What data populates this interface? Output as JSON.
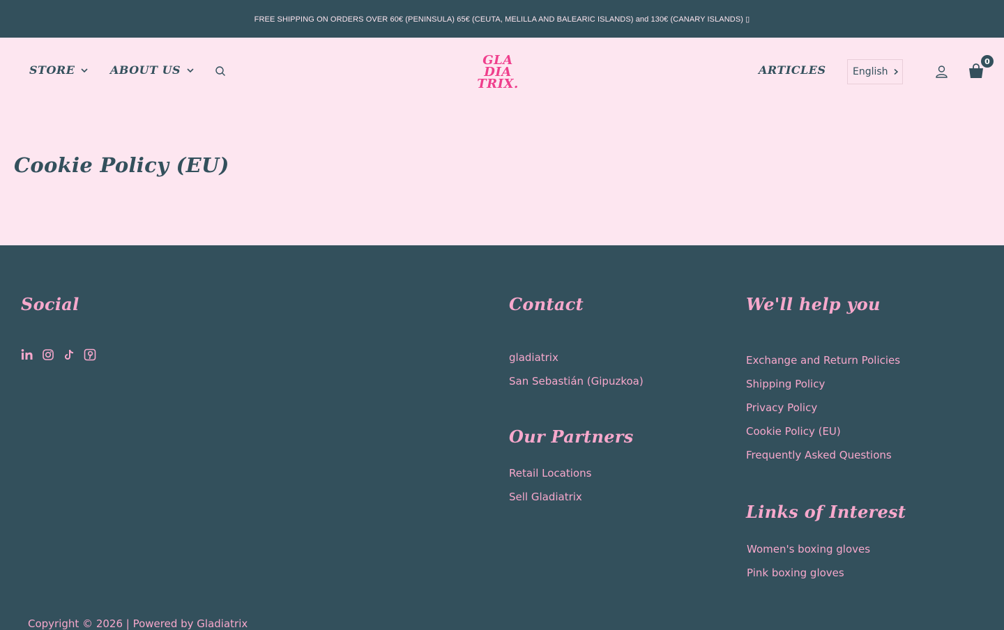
{
  "announcement": "FREE SHIPPING ON ORDERS OVER 60€ (PENINSULA) 65€ (CEUTA, MELILLA AND BALEARIC ISLANDS) and 130€ (CANARY ISLANDS) ▯",
  "nav": {
    "store": "STORE",
    "about": "ABOUT US",
    "articles": "ARTICLES",
    "language": "English",
    "cart_count": "0"
  },
  "logo": [
    "GLA",
    "DIA",
    "TRIX."
  ],
  "page": {
    "title": "Cookie Policy (EU)"
  },
  "footer": {
    "social": {
      "heading": "Social",
      "icons": [
        "linkedin-icon",
        "instagram-icon",
        "tiktok-icon",
        "pinterest-icon"
      ]
    },
    "contact": {
      "heading": "Contact",
      "items": [
        "gladiatrix",
        "San Sebastián (Gipuzkoa)"
      ]
    },
    "partners": {
      "heading": "Our Partners",
      "items": [
        "Retail Locations",
        "Sell Gladiatrix"
      ]
    },
    "help": {
      "heading": "We'll help you",
      "items": [
        "Exchange and Return Policies",
        "Shipping Policy",
        "Privacy Policy",
        "Cookie Policy (EU)",
        "Frequently Asked Questions"
      ]
    },
    "interest": {
      "heading": "Links of Interest",
      "items": [
        "Women's boxing gloves",
        "Pink boxing gloves"
      ]
    },
    "copyright": "Copyright © 2026 | Powered by Gladiatrix"
  },
  "colors": {
    "dark": "#33505c",
    "pink_bg": "#fde6f0",
    "pink_text": "#f7a8cc",
    "brand": "#ef3e8c"
  }
}
